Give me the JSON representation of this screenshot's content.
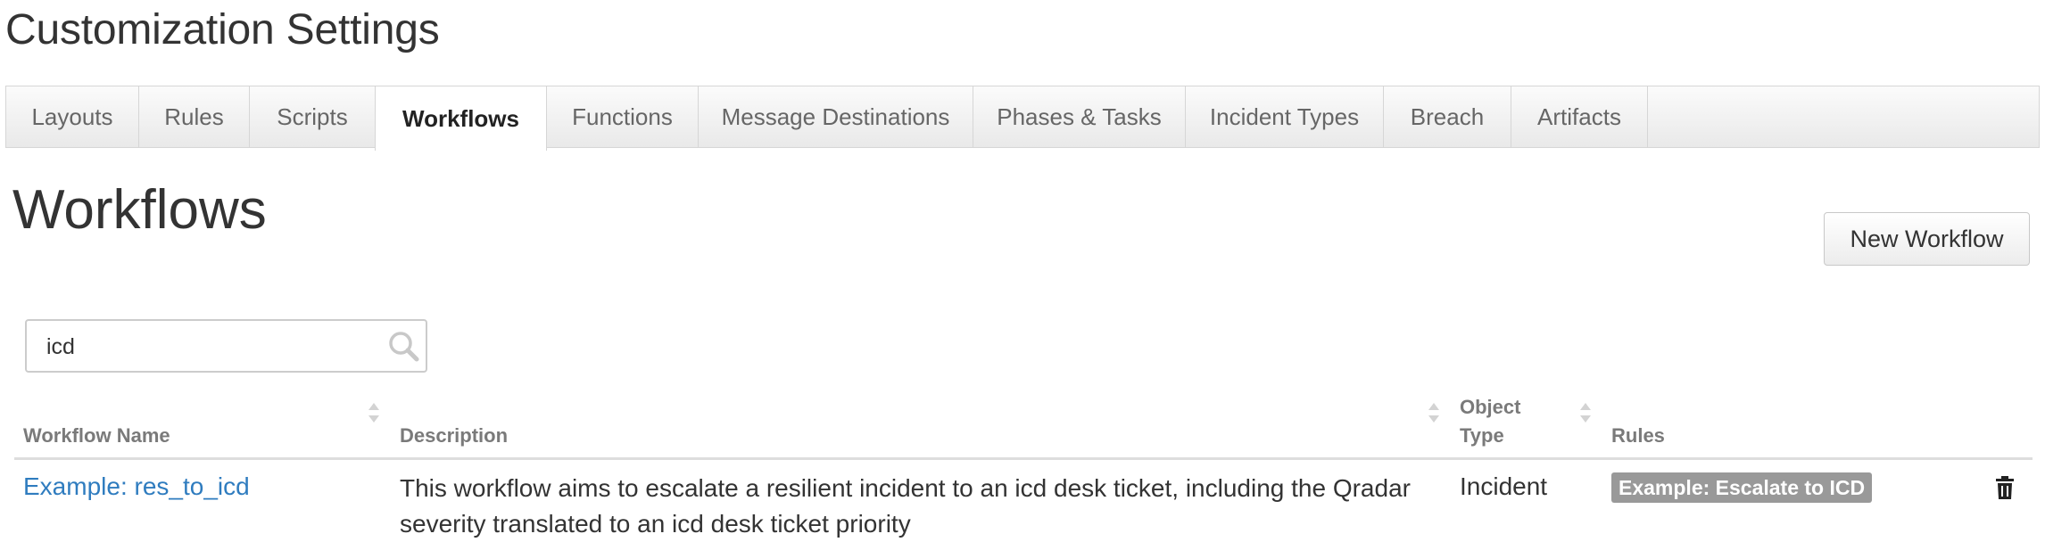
{
  "page": {
    "title": "Customization Settings"
  },
  "tabs": [
    {
      "label": "Layouts",
      "active": false
    },
    {
      "label": "Rules",
      "active": false
    },
    {
      "label": "Scripts",
      "active": false
    },
    {
      "label": "Workflows",
      "active": true
    },
    {
      "label": "Functions",
      "active": false
    },
    {
      "label": "Message Destinations",
      "active": false
    },
    {
      "label": "Phases & Tasks",
      "active": false
    },
    {
      "label": "Incident Types",
      "active": false
    },
    {
      "label": "Breach",
      "active": false
    },
    {
      "label": "Artifacts",
      "active": false
    }
  ],
  "section": {
    "title": "Workflows",
    "new_button_label": "New Workflow"
  },
  "search": {
    "value": "icd",
    "icon": "search-icon"
  },
  "table": {
    "columns": {
      "name": "Workflow Name",
      "description": "Description",
      "object_type_line1": "Object",
      "object_type_line2": "Type",
      "rules": "Rules"
    },
    "rows": [
      {
        "name": "Example: res_to_icd",
        "description": "This workflow aims to escalate a resilient incident to an icd desk ticket, including the Qradar severity translated to an icd desk ticket priority",
        "object_type": "Incident",
        "rules": [
          "Example: Escalate to ICD"
        ],
        "delete_icon": "trash-icon"
      }
    ]
  },
  "colors": {
    "link": "#2f7cbf",
    "badge_bg": "#999999",
    "header_text": "#7a7a7a"
  }
}
